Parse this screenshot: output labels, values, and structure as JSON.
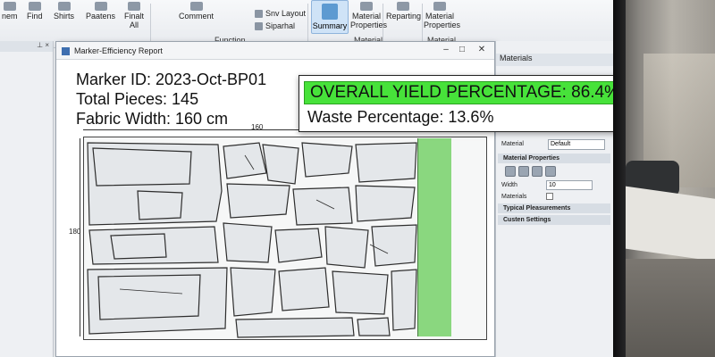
{
  "ribbon": {
    "items": [
      {
        "label": "nem"
      },
      {
        "label": "Find"
      },
      {
        "label": "Shirts"
      },
      {
        "label": "Paatens"
      },
      {
        "label": "Finalt All"
      },
      {
        "label": "Comment"
      },
      {
        "label": "Snv Layout"
      },
      {
        "label": "Siparhal"
      },
      {
        "label": "Summary"
      },
      {
        "label": "Material Properties"
      },
      {
        "label": "Reparting"
      },
      {
        "label": "Material Properties"
      }
    ],
    "groups": [
      {
        "label": "Function"
      },
      {
        "label": "Material"
      },
      {
        "label": "Material"
      }
    ]
  },
  "report": {
    "title": "Marker-Efficiency Report",
    "marker_id": "Marker ID: 2023-Oct-BP01",
    "total_pieces": "Total Pieces: 145",
    "fabric_width": "Fabric Width: 160 cm",
    "ruler_top": "160",
    "ruler_left": "180"
  },
  "callout": {
    "yield": "OVERALL YIELD PERCENTAGE: 86.4%",
    "waste": "Waste Percentage: 13.6%"
  },
  "materials_pane": {
    "title": "Materials",
    "material_label": "Material",
    "material_value": "Default",
    "section_properties": "Material Properties",
    "width_label": "Width",
    "width_value": "10",
    "materials_label": "Materials",
    "section_measurements": "Typical Pleasurements",
    "section_settings": "Custen Settings"
  },
  "colors": {
    "yield_highlight": "#47e23a",
    "fabric_waste_strip": "#8ad77f",
    "summary_active": "#cfe3f7"
  }
}
